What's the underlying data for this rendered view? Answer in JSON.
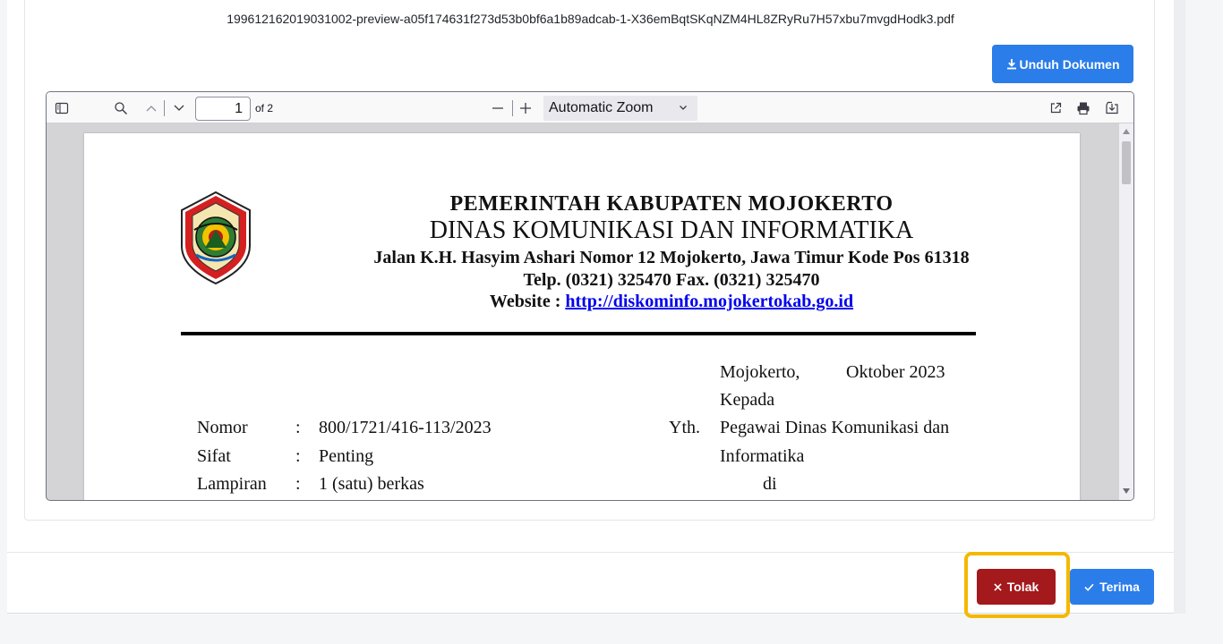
{
  "document": {
    "filename": "199612162019031002-preview-a05f174631f273d53b0bf6a1b89adcab-1-X36emBqtSKqNZM4HL8ZRyRu7H57xbu7mvgdHodk3.pdf",
    "download_label": "Unduh Dokumen"
  },
  "viewer": {
    "page_number": "1",
    "page_count_label": "of 2",
    "zoom_label": "Automatic Zoom"
  },
  "letter": {
    "header_line1": "PEMERINTAH  KABUPATEN  MOJOKERTO",
    "header_line2": "DINAS KOMUNIKASI DAN INFORMATIKA",
    "address": "Jalan K.H. Hasyim Ashari Nomor 12 Mojokerto, Jawa Timur Kode Pos 61318",
    "phone": "Telp. (0321) 325470 Fax. (0321) 325470",
    "website_label": "Website : ",
    "website_url": "http://diskominfo.mojokertokab.go.id",
    "place": "Mojokerto,",
    "date": "Oktober 2023",
    "to_label": "Kepada",
    "yth": "Yth.",
    "recipient_line1": "Pegawai Dinas Komunikasi dan",
    "recipient_line2": "Informatika",
    "recipient_line3": "di",
    "fields": [
      {
        "label": "Nomor",
        "colon": ":",
        "value": "800/1721/416-113/2023"
      },
      {
        "label": "Sifat",
        "colon": ":",
        "value": "Penting"
      },
      {
        "label": "Lampiran",
        "colon": ":",
        "value": "1 (satu) berkas"
      }
    ]
  },
  "footer": {
    "reject_label": "Tolak",
    "accept_label": "Terima"
  },
  "colors": {
    "primary": "#2b7de9",
    "danger": "#a3191c",
    "highlight": "#f5b800"
  }
}
